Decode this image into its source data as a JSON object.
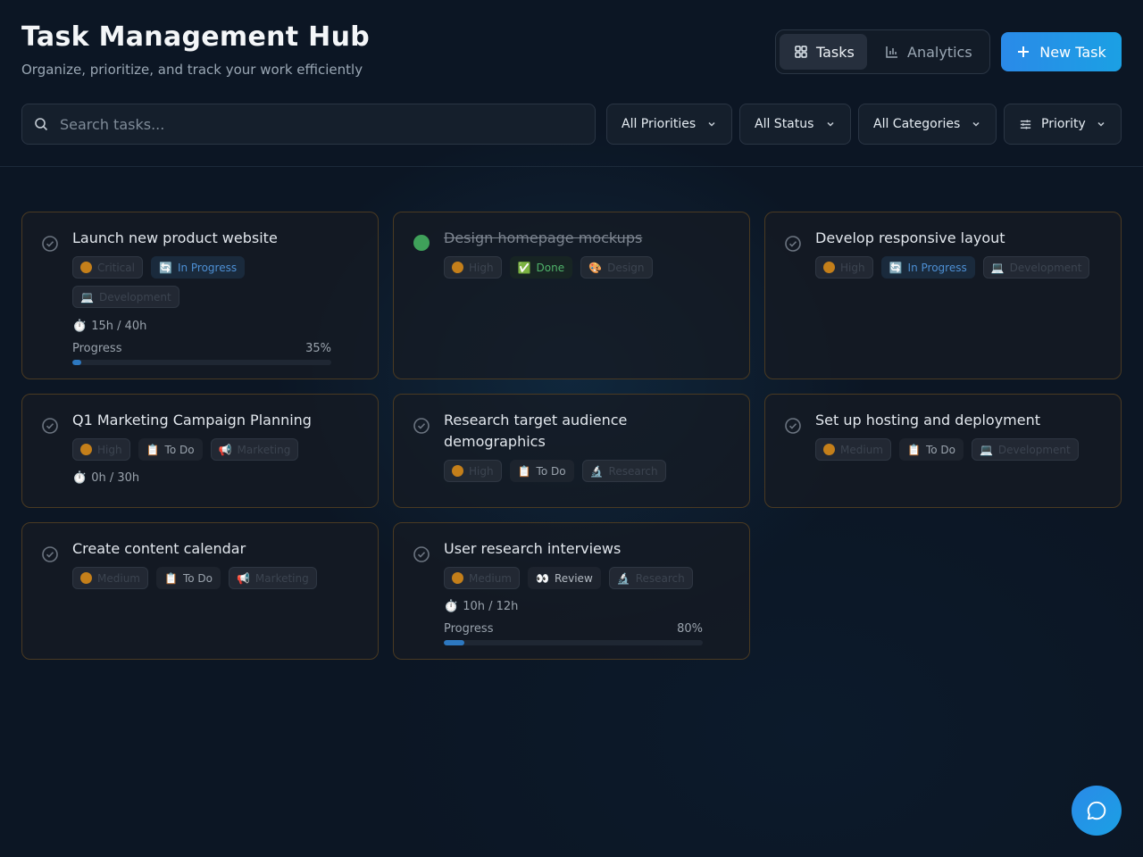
{
  "header": {
    "title": "Task Management Hub",
    "subtitle": "Organize, prioritize, and track your work efficiently"
  },
  "view_toggle": {
    "tasks_label": "Tasks",
    "analytics_label": "Analytics",
    "active": "Tasks"
  },
  "actions": {
    "new_task_label": "New Task"
  },
  "search": {
    "placeholder": "Search tasks..."
  },
  "filters": {
    "priority": "All Priorities",
    "status": "All Status",
    "category": "All Categories",
    "sort": "Priority"
  },
  "tasks": [
    {
      "title": "Launch new product website",
      "priority": "Critical",
      "status_icon": "🔄",
      "status": "In Progress",
      "category_icon": "💻",
      "category": "Development",
      "hours": "15h / 40h",
      "progress_label": "Progress",
      "progress_text": "35%",
      "progress": 0.035
    },
    {
      "title": "Design homepage mockups",
      "priority": "High",
      "status_icon": "✅",
      "status": "Done",
      "category_icon": "🎨",
      "category": "Design",
      "completed": true
    },
    {
      "title": "Develop responsive layout",
      "priority": "High",
      "status_icon": "🔄",
      "status": "In Progress",
      "category_icon": "💻",
      "category": "Development"
    },
    {
      "title": "Q1 Marketing Campaign Planning",
      "priority": "High",
      "status_icon": "📋",
      "status": "To Do",
      "category_icon": "📢",
      "category": "Marketing",
      "hours": "0h / 30h"
    },
    {
      "title": "Research target audience demographics",
      "priority": "High",
      "status_icon": "📋",
      "status": "To Do",
      "category_icon": "🔬",
      "category": "Research"
    },
    {
      "title": "Set up hosting and deployment",
      "priority": "Medium",
      "status_icon": "📋",
      "status": "To Do",
      "category_icon": "💻",
      "category": "Development"
    },
    {
      "title": "Create content calendar",
      "priority": "Medium",
      "status_icon": "📋",
      "status": "To Do",
      "category_icon": "📢",
      "category": "Marketing"
    },
    {
      "title": "User research interviews",
      "priority": "Medium",
      "status_icon": "👀",
      "status": "Review",
      "category_icon": "🔬",
      "category": "Research",
      "hours": "10h / 12h",
      "progress_label": "Progress",
      "progress_text": "80%",
      "progress": 0.08
    }
  ],
  "colors": {
    "accent": "#1e90e8",
    "priority_dot": "#c47f1a",
    "done": "#3fa15a",
    "card_border": "#4a3a22"
  }
}
